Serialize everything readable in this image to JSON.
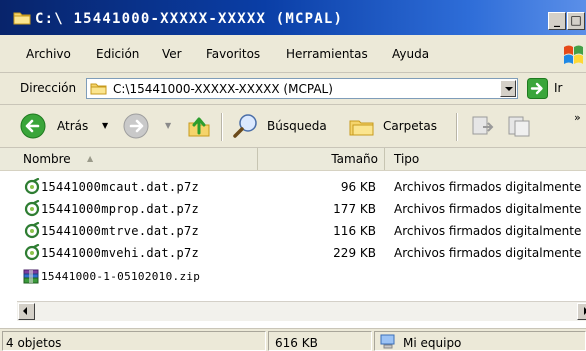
{
  "window": {
    "title": "C:\\ 15441000-XXXXX-XXXXX (MCPAL)",
    "minimize": "_",
    "maximize": "□",
    "close": "×"
  },
  "menu": [
    {
      "label": "Archivo"
    },
    {
      "label": "Edición"
    },
    {
      "label": "Ver"
    },
    {
      "label": "Favoritos"
    },
    {
      "label": "Herramientas"
    },
    {
      "label": "Ayuda"
    }
  ],
  "address": {
    "label": "Dirección",
    "value": "C:\\15441000-XXXXX-XXXXX (MCPAL)",
    "go_label": "Ir"
  },
  "toolbar": {
    "back_label": "Atrás",
    "search_label": "Búsqueda",
    "folders_label": "Carpetas",
    "overflow": "»"
  },
  "list": {
    "columns": [
      "Nombre",
      "Tamaño",
      "Tipo"
    ],
    "rows": [
      {
        "name": "15441000mcaut.dat.p7z",
        "size": "96 KB",
        "type": "Archivos firmados digitalmente",
        "icon": "signed-file-icon"
      },
      {
        "name": "15441000mprop.dat.p7z",
        "size": "177 KB",
        "type": "Archivos firmados digitalmente",
        "icon": "signed-file-icon"
      },
      {
        "name": "15441000mtrve.dat.p7z",
        "size": "116 KB",
        "type": "Archivos firmados digitalmente",
        "icon": "signed-file-icon"
      },
      {
        "name": "15441000mvehi.dat.p7z",
        "size": "229 KB",
        "type": "Archivos firmados digitalmente",
        "icon": "signed-file-icon"
      },
      {
        "name": "15441000-1-05102010.zip",
        "size": "",
        "type": "",
        "icon": "archive-file-icon"
      }
    ]
  },
  "status": {
    "count": "4 objetos",
    "size": "616 KB",
    "location": "Mi equipo"
  }
}
